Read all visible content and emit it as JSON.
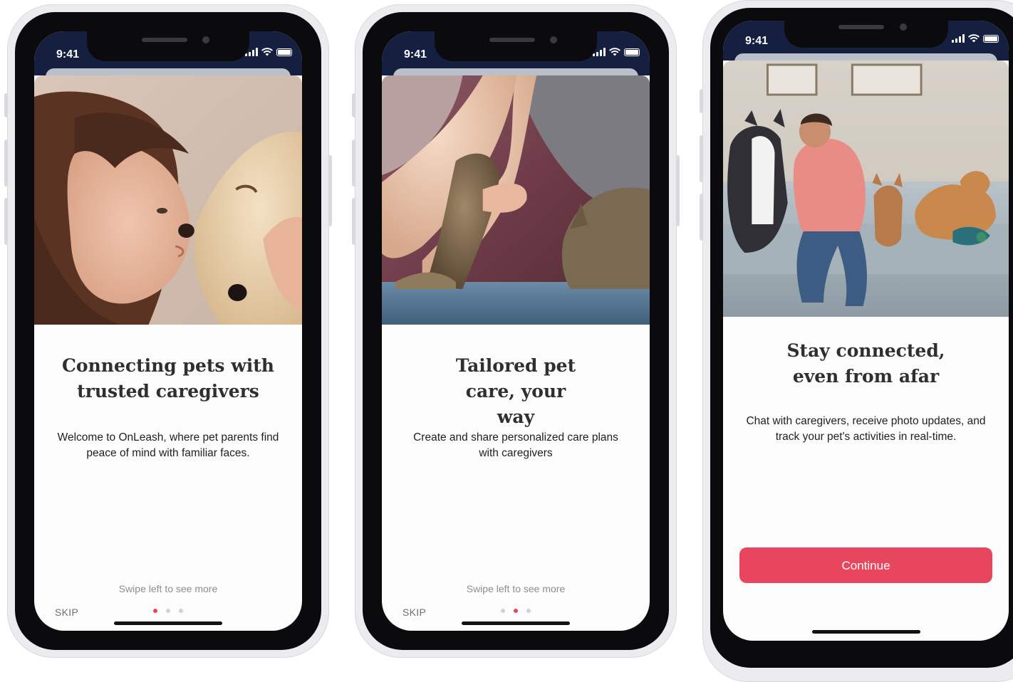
{
  "screens": [
    {
      "time": "9:41",
      "title": "Connecting pets with trusted caregivers",
      "description": "Welcome to OnLeash, where pet parents find peace of mind with familiar faces.",
      "swipe_hint": "Swipe left to see more",
      "skip_label": "SKIP",
      "active_dot": 1,
      "total_dots": 3
    },
    {
      "time": "9:41",
      "title": "Tailored pet care, your way",
      "description": "Create and share personalized care plans with caregivers",
      "swipe_hint": "Swipe left to see more",
      "skip_label": "SKIP",
      "active_dot": 2,
      "total_dots": 3
    },
    {
      "time": "9:41",
      "title": "Stay connected, even from afar",
      "description": "Chat with caregivers, receive photo updates, and track your pet's activities in real-time.",
      "continue_label": "Continue"
    }
  ],
  "colors": {
    "accent": "#e8455f",
    "status_bar": "#152041",
    "title_text": "#2f2f2f",
    "muted_text": "#8e8e93"
  },
  "icons": [
    "signal-icon",
    "wifi-icon",
    "battery-icon"
  ]
}
